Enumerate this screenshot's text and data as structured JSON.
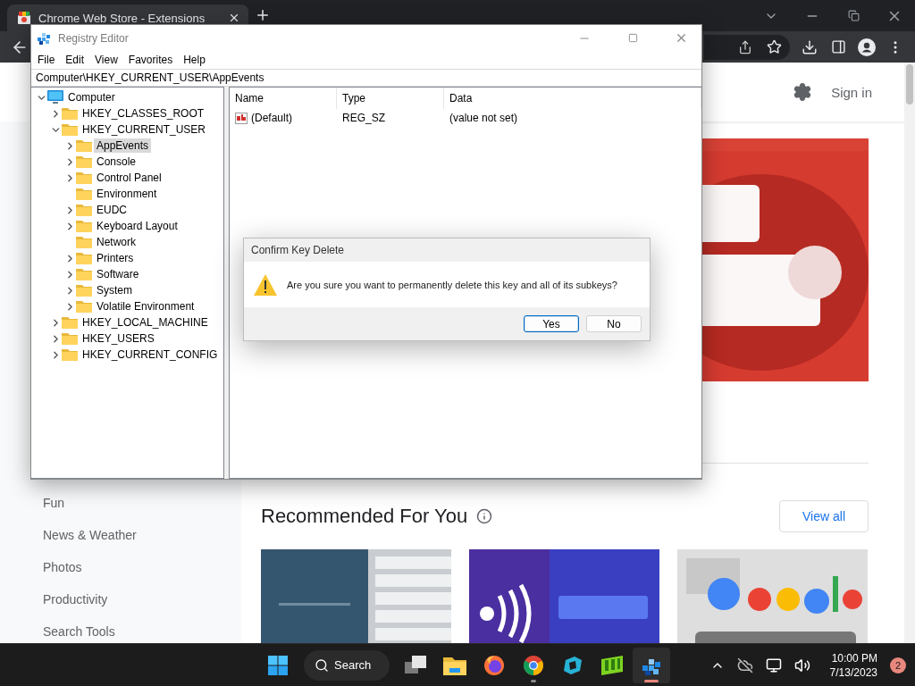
{
  "browser": {
    "tab": {
      "title": "Chrome Web Store - Extensions"
    },
    "header": {
      "sign_in": "Sign in"
    },
    "sidebar": {
      "items": [
        {
          "label": "Fun"
        },
        {
          "label": "News & Weather"
        },
        {
          "label": "Photos"
        },
        {
          "label": "Productivity"
        },
        {
          "label": "Search Tools"
        }
      ]
    },
    "section": {
      "title": "Recommended For You",
      "view_all": "View all"
    }
  },
  "registry_editor": {
    "title": "Registry Editor",
    "menu": [
      "File",
      "Edit",
      "View",
      "Favorites",
      "Help"
    ],
    "address": "Computer\\HKEY_CURRENT_USER\\AppEvents",
    "tree": [
      {
        "label": "Computer",
        "kind": "computer",
        "expandable": true,
        "expanded": true,
        "selected": false,
        "children": [
          {
            "label": "HKEY_CLASSES_ROOT",
            "kind": "folder",
            "expandable": true,
            "expanded": false,
            "selected": false
          },
          {
            "label": "HKEY_CURRENT_USER",
            "kind": "folder",
            "expandable": true,
            "expanded": true,
            "selected": false,
            "children": [
              {
                "label": "AppEvents",
                "kind": "folder",
                "expandable": true,
                "expanded": false,
                "selected": true
              },
              {
                "label": "Console",
                "kind": "folder",
                "expandable": true,
                "expanded": false,
                "selected": false
              },
              {
                "label": "Control Panel",
                "kind": "folder",
                "expandable": true,
                "expanded": false,
                "selected": false
              },
              {
                "label": "Environment",
                "kind": "folder",
                "expandable": false,
                "selected": false
              },
              {
                "label": "EUDC",
                "kind": "folder",
                "expandable": true,
                "expanded": false,
                "selected": false
              },
              {
                "label": "Keyboard Layout",
                "kind": "folder",
                "expandable": true,
                "expanded": false,
                "selected": false
              },
              {
                "label": "Network",
                "kind": "folder",
                "expandable": false,
                "selected": false
              },
              {
                "label": "Printers",
                "kind": "folder",
                "expandable": true,
                "expanded": false,
                "selected": false
              },
              {
                "label": "Software",
                "kind": "folder",
                "expandable": true,
                "expanded": false,
                "selected": false
              },
              {
                "label": "System",
                "kind": "folder",
                "expandable": true,
                "expanded": false,
                "selected": false
              },
              {
                "label": "Volatile Environment",
                "kind": "folder",
                "expandable": true,
                "expanded": false,
                "selected": false
              }
            ]
          },
          {
            "label": "HKEY_LOCAL_MACHINE",
            "kind": "folder",
            "expandable": true,
            "expanded": false,
            "selected": false
          },
          {
            "label": "HKEY_USERS",
            "kind": "folder",
            "expandable": true,
            "expanded": false,
            "selected": false
          },
          {
            "label": "HKEY_CURRENT_CONFIG",
            "kind": "folder",
            "expandable": true,
            "expanded": false,
            "selected": false
          }
        ]
      }
    ],
    "columns": [
      "Name",
      "Type",
      "Data"
    ],
    "values": [
      {
        "name": "(Default)",
        "type": "REG_SZ",
        "data": "(value not set)"
      }
    ]
  },
  "dialog": {
    "title": "Confirm Key Delete",
    "message": "Are you sure you want to permanently delete this key and all of its subkeys?",
    "buttons": [
      {
        "label": "Yes",
        "selected": true
      },
      {
        "label": "No",
        "selected": false
      }
    ]
  },
  "taskbar": {
    "search": "Search",
    "apps": [
      {
        "kind": "taskview",
        "open": false,
        "active": false
      },
      {
        "kind": "explorer",
        "open": false,
        "active": false
      },
      {
        "kind": "firefox",
        "open": false,
        "active": false
      },
      {
        "kind": "chrome",
        "open": true,
        "active": false
      },
      {
        "kind": "cyan",
        "open": false,
        "active": false
      },
      {
        "kind": "green",
        "open": false,
        "active": false
      },
      {
        "kind": "registry",
        "open": true,
        "active": true
      }
    ],
    "time": "10:00 PM",
    "date": "7/13/2023",
    "badge": "2"
  }
}
